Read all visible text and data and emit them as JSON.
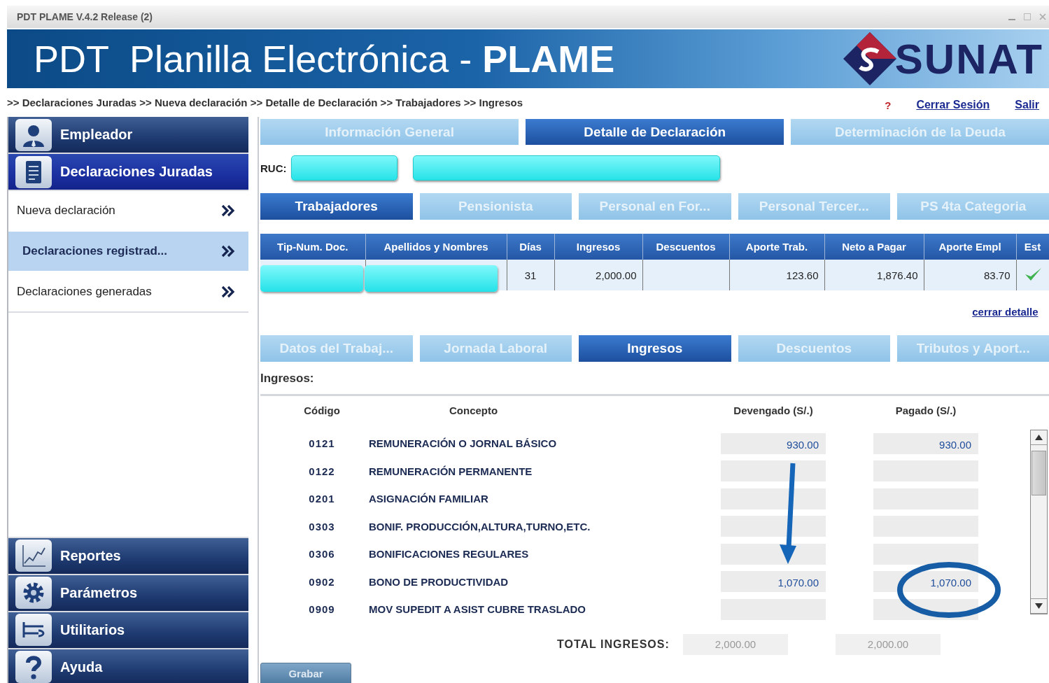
{
  "window": {
    "title": "PDT PLAME V.4.2 Release (2)"
  },
  "banner": {
    "title": "PDT  Planilla Electrónica - **PLAME**",
    "logo_text": "SUNAT"
  },
  "breadcrumb": ">> Declaraciones Juradas >> Nueva declaración >> Detalle de Declaración >> Trabajadores >> Ingresos",
  "top_links": [
    {
      "kind": "help",
      "label": "?"
    },
    {
      "kind": "link",
      "label": "Cerrar Sesión"
    },
    {
      "kind": "link",
      "label": "Salir"
    }
  ],
  "sidebar": {
    "sections_top": [
      {
        "label": "Empleador",
        "selected": false
      },
      {
        "label": "Declaraciones Juradas",
        "selected": true
      }
    ],
    "items": [
      {
        "label": "Nueva declaración",
        "selected": false
      },
      {
        "label": "Declaraciones registrad...",
        "selected": true
      },
      {
        "label": "Declaraciones generadas",
        "selected": false
      }
    ],
    "sections_bottom": [
      {
        "label": "Reportes",
        "selected": false
      },
      {
        "label": "Parámetros",
        "selected": false
      },
      {
        "label": "Utilitarios",
        "selected": false
      },
      {
        "label": "Ayuda",
        "selected": false
      }
    ]
  },
  "main_tabs": [
    {
      "label": "Información General",
      "selected": false
    },
    {
      "label": "Detalle de Declaración",
      "selected": true
    },
    {
      "label": "Determinación de la Deuda",
      "selected": false
    }
  ],
  "ruc": {
    "label": "RUC:",
    "redacted": true
  },
  "worker_tabs": [
    {
      "label": "Trabajadores",
      "selected": true
    },
    {
      "label": "Pensionista",
      "selected": false
    },
    {
      "label": "Personal en For...",
      "selected": false
    },
    {
      "label": "Personal Tercer...",
      "selected": false
    },
    {
      "label": "PS 4ta Categoria",
      "selected": false
    }
  ],
  "workers_table": {
    "columns": [
      "Tip-Num. Doc.",
      "Apellidos y Nombres",
      "Días",
      "Ingresos",
      "Descuentos",
      "Aporte Trab.",
      "Neto a Pagar",
      "Aporte Empl",
      "Est"
    ],
    "rows": [
      {
        "cells": [
          null,
          null,
          "31",
          "2,000.00",
          null,
          "123.60",
          "1,876.40",
          "83.70"
        ],
        "redacted": true,
        "status_ok": true
      }
    ]
  },
  "close_detail_link": "cerrar detalle",
  "detail_tabs": [
    {
      "label": "Datos del Trabaj...",
      "selected": false
    },
    {
      "label": "Jornada Laboral",
      "selected": false
    },
    {
      "label": "Ingresos",
      "selected": true
    },
    {
      "label": "Descuentos",
      "selected": false
    },
    {
      "label": "Tributos y Aport...",
      "selected": false
    }
  ],
  "ingresos": {
    "heading": "Ingresos:",
    "columns": [
      "Código",
      "Concepto",
      "Devengado (S/.)",
      "Pagado (S/.)"
    ],
    "rows": [
      {
        "code": "0121",
        "concept": "REMUNERACIÓN O JORNAL BÁSICO",
        "devengado": "930.00",
        "pagado": "930.00"
      },
      {
        "code": "0122",
        "concept": "REMUNERACIÓN PERMANENTE"
      },
      {
        "code": "0201",
        "concept": "ASIGNACIÓN FAMILIAR"
      },
      {
        "code": "0303",
        "concept": "BONIF. PRODUCCIÓN,ALTURA,TURNO,ETC."
      },
      {
        "code": "0306",
        "concept": "BONIFICACIONES REGULARES"
      },
      {
        "code": "0902",
        "concept": "BONO DE PRODUCTIVIDAD",
        "devengado": "1,070.00",
        "pagado": "1,070.00"
      },
      {
        "code": "0909",
        "concept": "MOV SUPEDIT A ASIST CUBRE TRASLADO"
      }
    ],
    "total_label": "TOTAL INGRESOS:",
    "total_devengado": "2,000.00",
    "total_pagado": "2,000.00"
  },
  "save_button": "Grabar"
}
